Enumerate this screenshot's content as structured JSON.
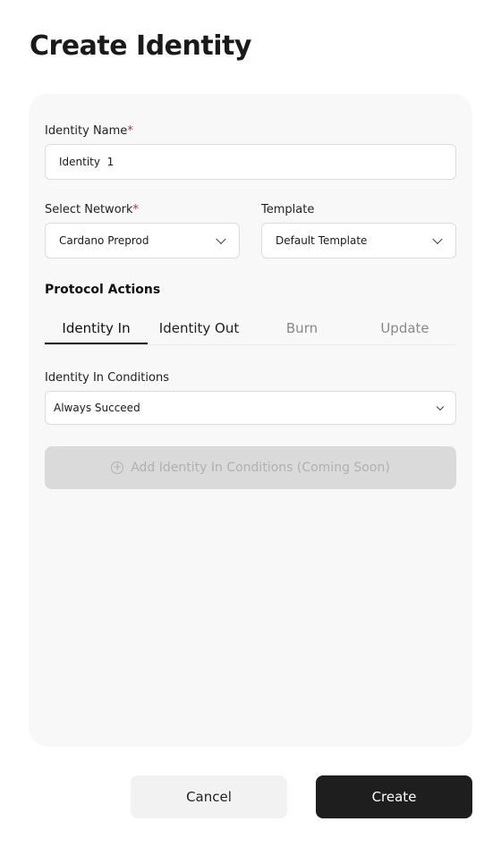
{
  "page_title": "Create Identity",
  "form": {
    "identity_name_label": "Identity Name",
    "required_mark": "*",
    "identity_name_value": "Identity  1",
    "network_label": "Select Network",
    "network_value": "Cardano Preprod",
    "template_label": "Template",
    "template_value": "Default Template",
    "protocol_actions_title": "Protocol Actions",
    "tabs": [
      {
        "label": "Identity In",
        "active": true
      },
      {
        "label": "Identity Out",
        "active": false
      },
      {
        "label": "Burn",
        "active": false
      },
      {
        "label": "Update",
        "active": false
      }
    ],
    "conditions_label": "Identity In Conditions",
    "conditions_value": "Always Succeed",
    "add_conditions_label": "Add Identity In Conditions (Coming Soon)"
  },
  "footer": {
    "cancel_label": "Cancel",
    "create_label": "Create"
  },
  "colors": {
    "required": "#e02020",
    "primary_button": "#1e1e1e",
    "card_bg": "#f8f8f8"
  }
}
